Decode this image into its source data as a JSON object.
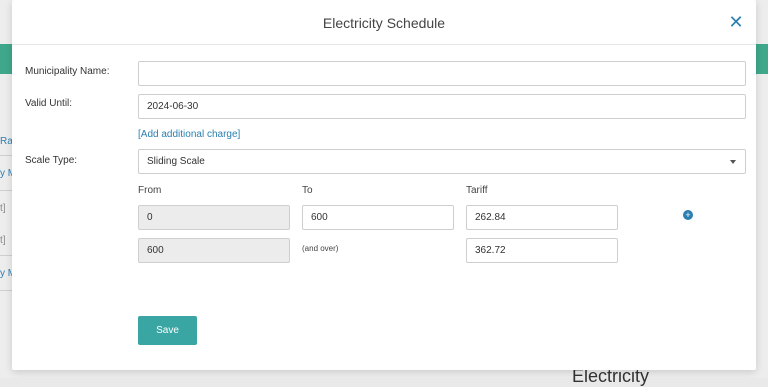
{
  "background": {
    "left_fragments": [
      "Ra",
      "y M",
      "t]",
      "t]",
      "y M"
    ],
    "heading": "Electricity"
  },
  "modal": {
    "title": "Electricity Schedule",
    "close_icon": "close-icon"
  },
  "form": {
    "municipality_label": "Municipality Name:",
    "municipality_value": "",
    "valid_until_label": "Valid Until:",
    "valid_until_value": "2024-06-30",
    "add_charge_link": "[Add additional charge]",
    "scale_type_label": "Scale Type:",
    "scale_type_value": "Sliding Scale"
  },
  "scale_table": {
    "headers": {
      "from": "From",
      "to": "To",
      "tariff": "Tariff"
    },
    "rows": [
      {
        "from": "0",
        "to": "600",
        "tariff": "262.84"
      },
      {
        "from": "600",
        "to_note": "(and over)",
        "tariff": "362.72"
      }
    ]
  },
  "actions": {
    "save_label": "Save"
  },
  "colors": {
    "accent": "#2a7fb0",
    "save": "#3aa6a3",
    "header_band": "#3fa88b"
  }
}
